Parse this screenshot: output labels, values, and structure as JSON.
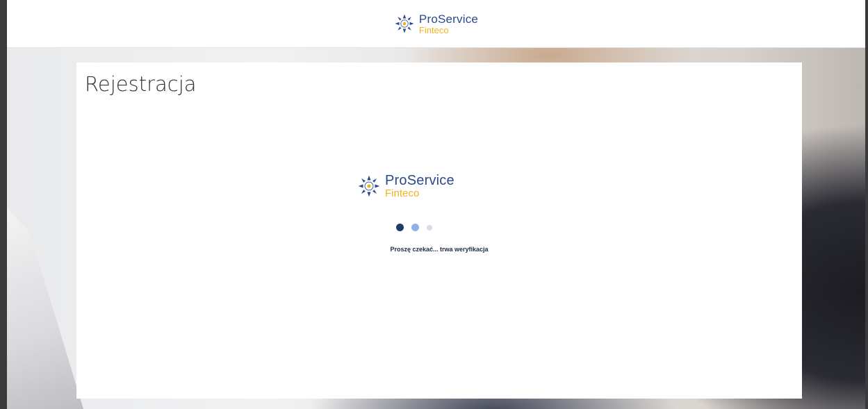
{
  "header": {
    "logo": {
      "name": "ProService",
      "sub": "Finteco",
      "icon": "proservice-star-logo-icon"
    }
  },
  "card": {
    "title": "Rejestracja",
    "loader": {
      "logo": {
        "name": "ProService",
        "sub": "Finteco"
      },
      "status_text": "Proszę czekać... trwa weryfikacja"
    }
  },
  "colors": {
    "brand_blue": "#2b4a8c",
    "brand_yellow": "#f2b31b",
    "dot_dark": "#1f3a6b",
    "dot_mid": "#8fb0ea",
    "dot_light": "#d6dbe6"
  }
}
